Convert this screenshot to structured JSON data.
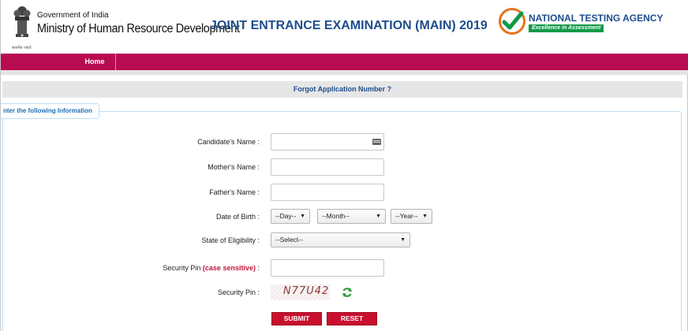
{
  "header": {
    "gov_small": "Government of India",
    "ministry": "Ministry of Human Resource Development",
    "hindi_caption": "सत्यमेव जयते",
    "exam_title": "JOINT ENTRANCE EXAMINATION (MAIN) 2019",
    "agency_name": "NATIONAL TESTING AGENCY",
    "agency_tagline": "Excellence in Assessment"
  },
  "nav": {
    "home": "Home"
  },
  "page": {
    "heading": "Forgot Application Number ?"
  },
  "form": {
    "legend": "nter the following Information",
    "candidate_name_label": "Candidate's Name :",
    "mother_name_label": "Mother's Name :",
    "father_name_label": "Father's Name :",
    "dob_label": "Date of Birth :",
    "dob_day": "--Day--",
    "dob_month": "--Month--",
    "dob_year": "--Year--",
    "state_label": "State of Eligibility :",
    "state_value": "--Select--",
    "security_pin_input_label": "Security Pin",
    "case_sensitive": "(case sensitive)",
    "colon": ":",
    "security_pin_label": "Security Pin :",
    "captcha_text": "N77U42",
    "submit": "SUBMIT",
    "reset": "RESET"
  },
  "colors": {
    "nav_bg": "#b80c50",
    "title_blue": "#1d4d8c",
    "button_red": "#c8102e",
    "nta_green": "#0e9a48"
  },
  "icons": [
    "state-emblem-icon",
    "nta-logo-icon",
    "keyboard-icon",
    "dropdown-arrow-icon",
    "refresh-icon"
  ]
}
